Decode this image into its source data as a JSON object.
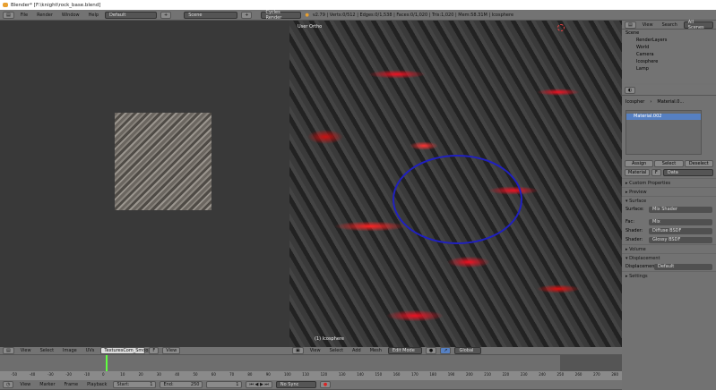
{
  "window": {
    "title": "Blender* [F:\\knight\\rock_base.blend]"
  },
  "info_header": {
    "menus": [
      "File",
      "Render",
      "Window",
      "Help"
    ],
    "layout": "Default",
    "scene": "Scene",
    "engine": "Cycles Render",
    "stats": "v2.79 | Verts:0/512 | Edges:0/1,538 | Faces:0/1,020 | Tris:1,020 | Mem:58.31M | Icosphere"
  },
  "viewport": {
    "view_label": "User Ortho",
    "object_label": "(1) Icosphere",
    "menus": [
      "View",
      "Select",
      "Add",
      "Mesh"
    ],
    "mode": "Edit Mode",
    "orientation": "Global"
  },
  "image_editor": {
    "menus": [
      "View",
      "Select",
      "Image",
      "UVs"
    ],
    "image_name": "TexturesCom_Smoo...",
    "image_users": "F",
    "view": "View"
  },
  "outliner": {
    "menus": [
      "View",
      "Search"
    ],
    "filter": "All Scenes",
    "items": [
      "Scene",
      "RenderLayers",
      "World",
      "Camera",
      "Icosphere",
      "Lamp"
    ]
  },
  "properties": {
    "breadcrumb": [
      "Icospher",
      "Material.0..."
    ],
    "material_slot": "Material.002",
    "buttons": [
      "Assign",
      "Select",
      "Deselect"
    ],
    "material_name": "Material",
    "users": "F",
    "link": "Data",
    "panels": {
      "custom": "Custom Properties",
      "preview": "Preview",
      "surface": "Surface",
      "volume": "Volume",
      "displacement": "Displacement",
      "settings": "Settings"
    },
    "surface": {
      "label": "Surface:",
      "value": "Mix Shader"
    },
    "inputs": [
      {
        "label": "Fac:",
        "value": "Mix"
      },
      {
        "label": "Shader:",
        "value": "Diffuse BSDF"
      },
      {
        "label": "Shader:",
        "value": "Glossy BSDF"
      }
    ],
    "displacement": {
      "label": "Displacement:",
      "value": "Default"
    }
  },
  "timeline": {
    "ticks": [
      "-50",
      "-40",
      "-30",
      "-20",
      "-10",
      "0",
      "10",
      "20",
      "30",
      "40",
      "50",
      "60",
      "70",
      "80",
      "90",
      "100",
      "110",
      "120",
      "130",
      "140",
      "150",
      "160",
      "170",
      "180",
      "190",
      "200",
      "210",
      "220",
      "230",
      "240",
      "250",
      "260",
      "270",
      "280"
    ],
    "current_frame_value": 0,
    "menus": [
      "View",
      "Marker",
      "Frame",
      "Playback"
    ],
    "start_label": "Start:",
    "start": "1",
    "end_label": "End:",
    "end": "250",
    "current": "1",
    "sync": "No Sync"
  },
  "colors": {
    "accent": "#5680c2",
    "current_frame": "#60ff40",
    "selection": "#2020c0"
  }
}
